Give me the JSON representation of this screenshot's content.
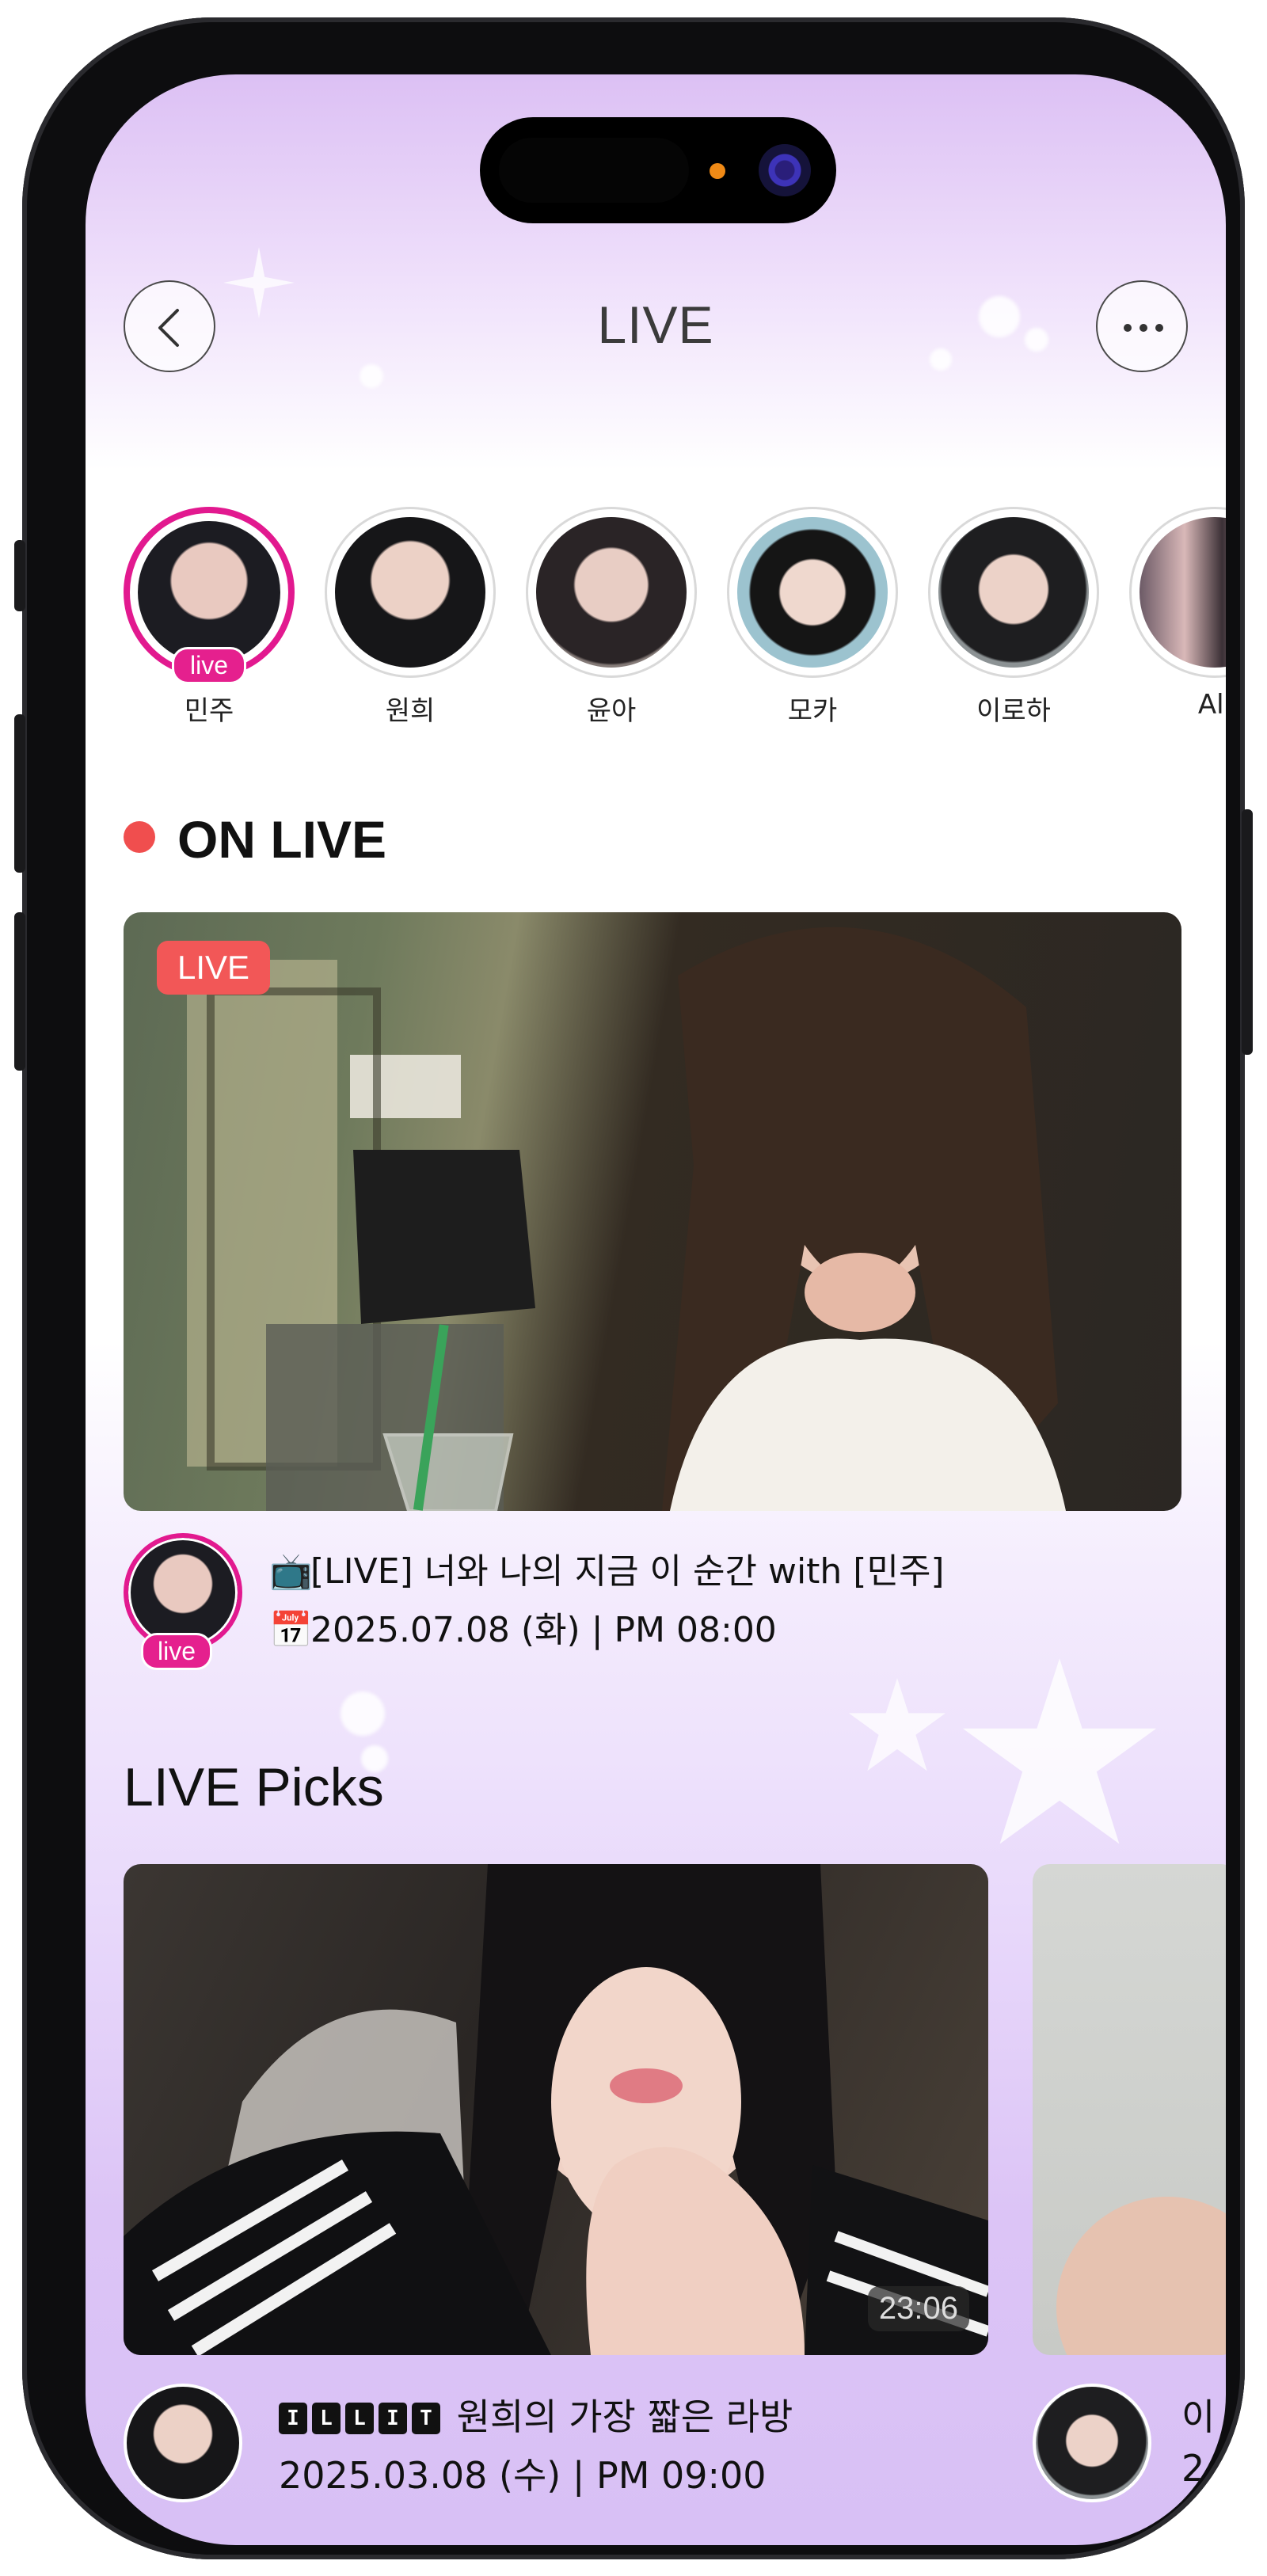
{
  "header": {
    "title": "LIVE"
  },
  "stories": [
    {
      "name": "민주",
      "live": true,
      "live_label": "live",
      "tone": "#3a3f48"
    },
    {
      "name": "원희",
      "live": false,
      "tone": "#2d2a2e"
    },
    {
      "name": "윤아",
      "live": false,
      "tone": "#3b3439"
    },
    {
      "name": "모카",
      "live": false,
      "tone": "#7fa8b8"
    },
    {
      "name": "이로하",
      "live": false,
      "tone": "#3c3e40"
    },
    {
      "name": "All",
      "live": false,
      "tone": "#5b4c55"
    }
  ],
  "on_live": {
    "heading": "ON LIVE",
    "badge": "LIVE",
    "avatar_live_label": "live",
    "title_icon": "📺",
    "title": "[LIVE] 너와 나의 지금 이 순간 with [민주]",
    "date_icon": "📅",
    "datetime": "2025.07.08 (화) | PM 08:00"
  },
  "picks": {
    "heading": "LIVE Picks",
    "items": [
      {
        "duration": "23:06",
        "tag_letters": [
          "I",
          "L",
          "L",
          "I",
          "T"
        ],
        "title": "원희의 가장 짧은 라방",
        "datetime": "2025.03.08 (수) | PM 09:00"
      },
      {
        "title_partial": "이",
        "datetime_partial": "2"
      }
    ]
  },
  "colors": {
    "accent_pink": "#e2198f",
    "live_red": "#f25757",
    "bg_lavender": "#dcc0f4"
  }
}
